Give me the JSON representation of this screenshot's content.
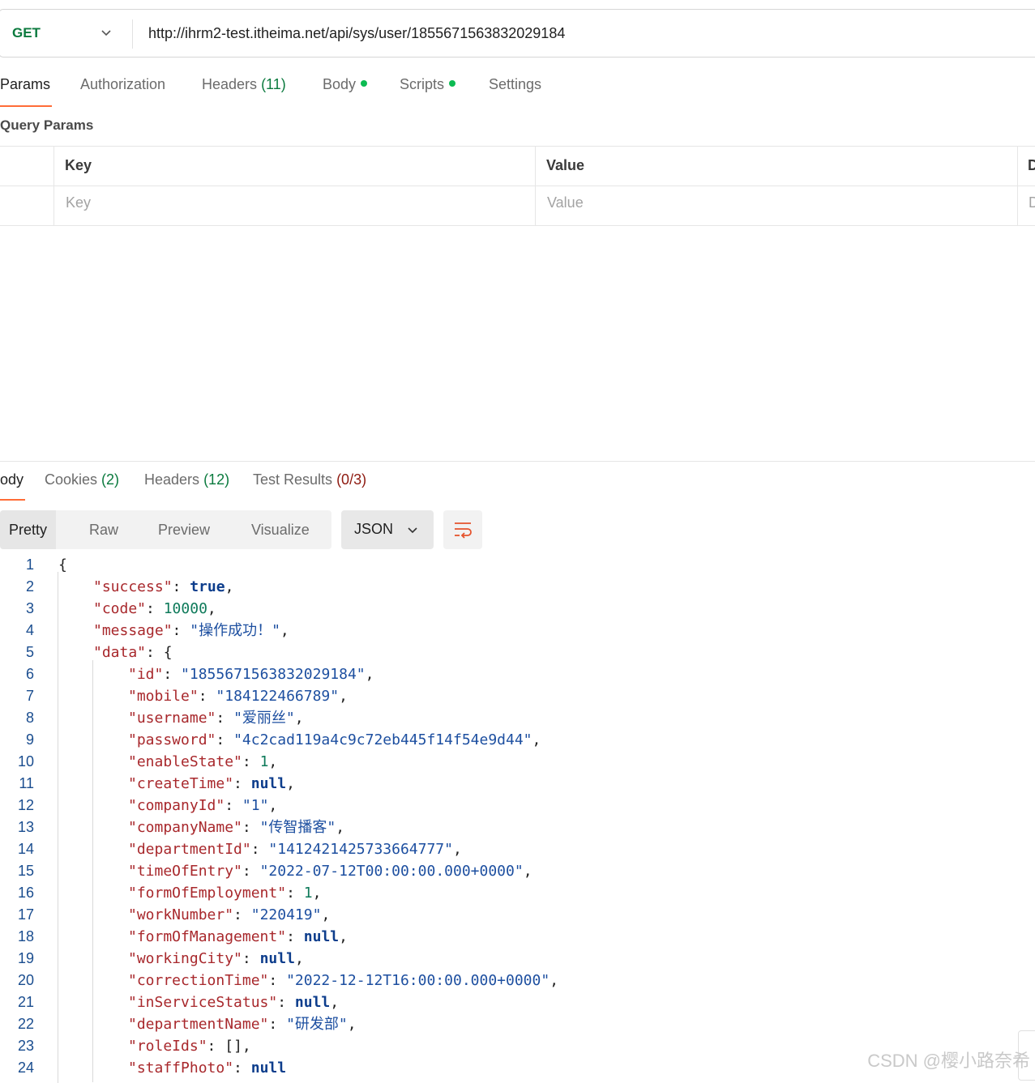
{
  "request": {
    "method": "GET",
    "url": "http://ihrm2-test.itheima.net/api/sys/user/1855671563832029184"
  },
  "request_tabs": {
    "params": "Params",
    "authorization": "Authorization",
    "headers": "Headers",
    "headers_count": "(11)",
    "body": "Body",
    "scripts": "Scripts",
    "settings": "Settings"
  },
  "query_params": {
    "title": "Query Params",
    "col_key": "Key",
    "col_value": "Value",
    "col_desc_cut": "D",
    "key_placeholder": "Key",
    "value_placeholder": "Value",
    "desc_placeholder_cut": "D"
  },
  "response_tabs": {
    "body": "ody",
    "cookies": "Cookies",
    "cookies_count": "(2)",
    "headers": "Headers",
    "headers_count": "(12)",
    "tests": "Test Results",
    "tests_count": "(0/3)"
  },
  "view": {
    "pretty": "Pretty",
    "raw": "Raw",
    "preview": "Preview",
    "visualize": "Visualize",
    "format": "JSON"
  },
  "json_lines": [
    {
      "n": "1",
      "key": "",
      "val": "{",
      "vt": "p",
      "end": "",
      "indent": 0
    },
    {
      "n": "2",
      "key": "success",
      "val": "true",
      "vt": "b",
      "end": ",",
      "indent": 1
    },
    {
      "n": "3",
      "key": "code",
      "val": "10000",
      "vt": "n",
      "end": ",",
      "indent": 1
    },
    {
      "n": "4",
      "key": "message",
      "val": "\"操作成功！\"",
      "vt": "s",
      "end": ",",
      "indent": 1
    },
    {
      "n": "5",
      "key": "data",
      "val": "{",
      "vt": "p",
      "end": "",
      "indent": 1
    },
    {
      "n": "6",
      "key": "id",
      "val": "\"1855671563832029184\"",
      "vt": "s",
      "end": ",",
      "indent": 2
    },
    {
      "n": "7",
      "key": "mobile",
      "val": "\"184122466789\"",
      "vt": "s",
      "end": ",",
      "indent": 2
    },
    {
      "n": "8",
      "key": "username",
      "val": "\"爱丽丝\"",
      "vt": "s",
      "end": ",",
      "indent": 2
    },
    {
      "n": "9",
      "key": "password",
      "val": "\"4c2cad119a4c9c72eb445f14f54e9d44\"",
      "vt": "s",
      "end": ",",
      "indent": 2
    },
    {
      "n": "10",
      "key": "enableState",
      "val": "1",
      "vt": "n",
      "end": ",",
      "indent": 2
    },
    {
      "n": "11",
      "key": "createTime",
      "val": "null",
      "vt": "b",
      "end": ",",
      "indent": 2
    },
    {
      "n": "12",
      "key": "companyId",
      "val": "\"1\"",
      "vt": "s",
      "end": ",",
      "indent": 2
    },
    {
      "n": "13",
      "key": "companyName",
      "val": "\"传智播客\"",
      "vt": "s",
      "end": ",",
      "indent": 2
    },
    {
      "n": "14",
      "key": "departmentId",
      "val": "\"1412421425733664777\"",
      "vt": "s",
      "end": ",",
      "indent": 2
    },
    {
      "n": "15",
      "key": "timeOfEntry",
      "val": "\"2022-07-12T00:00:00.000+0000\"",
      "vt": "s",
      "end": ",",
      "indent": 2
    },
    {
      "n": "16",
      "key": "formOfEmployment",
      "val": "1",
      "vt": "n",
      "end": ",",
      "indent": 2
    },
    {
      "n": "17",
      "key": "workNumber",
      "val": "\"220419\"",
      "vt": "s",
      "end": ",",
      "indent": 2
    },
    {
      "n": "18",
      "key": "formOfManagement",
      "val": "null",
      "vt": "b",
      "end": ",",
      "indent": 2
    },
    {
      "n": "19",
      "key": "workingCity",
      "val": "null",
      "vt": "b",
      "end": ",",
      "indent": 2
    },
    {
      "n": "20",
      "key": "correctionTime",
      "val": "\"2022-12-12T16:00:00.000+0000\"",
      "vt": "s",
      "end": ",",
      "indent": 2
    },
    {
      "n": "21",
      "key": "inServiceStatus",
      "val": "null",
      "vt": "b",
      "end": ",",
      "indent": 2
    },
    {
      "n": "22",
      "key": "departmentName",
      "val": "\"研发部\"",
      "vt": "s",
      "end": ",",
      "indent": 2
    },
    {
      "n": "23",
      "key": "roleIds",
      "val": "[]",
      "vt": "p",
      "end": ",",
      "indent": 2
    },
    {
      "n": "24",
      "key": "staffPhoto",
      "val": "null",
      "vt": "b",
      "end": "",
      "indent": 2
    }
  ],
  "watermark": "CSDN @樱小路奈希",
  "colors": {
    "accent": "#ff6c37",
    "method_get": "#0b7a3e",
    "status_dot": "#0cbb52",
    "json_key": "#a8282c",
    "json_string": "#1d4fa0",
    "json_number": "#0e7a5a",
    "json_keyword": "#0d3d8c"
  }
}
